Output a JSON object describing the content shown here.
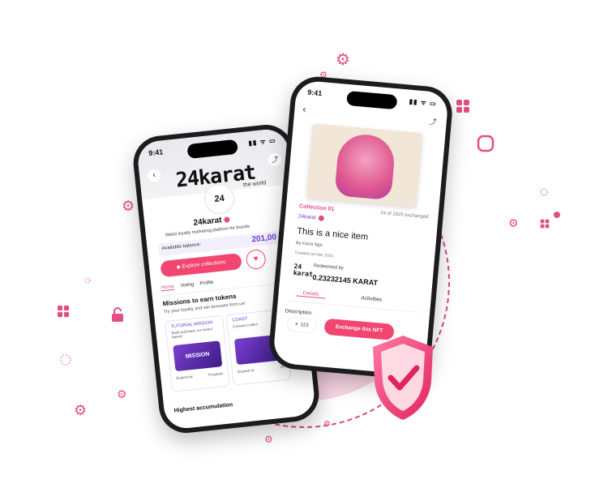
{
  "colors": {
    "accent": "#f2456f",
    "purple": "#6b3fd1",
    "bg_blob": "#f7d7e4"
  },
  "left_phone": {
    "time": "9:41",
    "status_icons": "▮▮ ᯤ ▭",
    "brand_word": "24karat",
    "brand_sub": "the world",
    "logo_badge": "24",
    "name": "24karat",
    "description": "Web3 loyalty marketing platform for brands",
    "balance_label": "Available balance:",
    "balance_value": "201,00",
    "explore_button": "Explore collections",
    "tabs": [
      "Home",
      "Voting",
      "Profile"
    ],
    "missions_title": "Missions to earn tokens",
    "missions_sub": "Try your loyalty and win bonuses from us!",
    "cards": [
      {
        "title": "TUTORIAL MISSION",
        "desc": "Build and learn our brand bases!",
        "image_text": "MISSION",
        "expired": "Expired at",
        "progress": "Progress"
      },
      {
        "title": "COAST",
        "desc": "Connect collect",
        "image_text": "",
        "expired": "Expired at",
        "progress": "Pr"
      }
    ],
    "bottom_text": "Highest accumulation"
  },
  "right_phone": {
    "time": "9:41",
    "status_icons": "▮▮ ᯤ ▭",
    "collection": "Collection 01",
    "exchanged": "24 of 1629 exchanged",
    "brand": "24karat",
    "title": "This is a nice item",
    "author": "By Kiichi Ngo",
    "created": "Created on Dec 2021",
    "karat_logo": "24 karat",
    "redeemed_label": "Redeemed by",
    "redeemed_value": "0.23232145 KARAT",
    "tabs": [
      "Details",
      "Activities"
    ],
    "description_label": "Description",
    "likes": "123",
    "exchange_button": "Exchange this NFT"
  },
  "icons": {
    "gear": "gear-icon",
    "lock": "lock-icon",
    "grid": "grid-icon",
    "shield": "shield-check-icon"
  }
}
